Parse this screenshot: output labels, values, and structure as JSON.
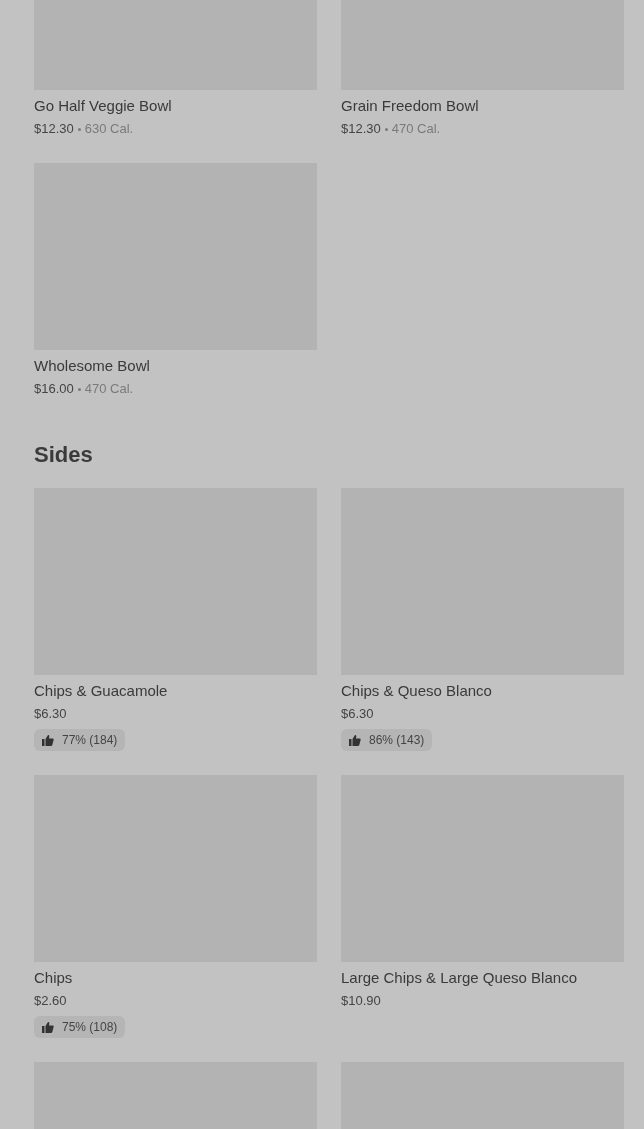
{
  "sections": [
    {
      "items": [
        {
          "kind": "item",
          "name": "Go Half Veggie Bowl",
          "price": "$12.30",
          "calories": "630 Cal."
        },
        {
          "kind": "item",
          "name": "Grain Freedom Bowl",
          "price": "$12.30",
          "calories": "470 Cal."
        },
        {
          "kind": "item",
          "name": "Wholesome Bowl",
          "price": "$16.00",
          "calories": "470 Cal."
        }
      ]
    },
    {
      "title": "Sides",
      "items": [
        {
          "kind": "item",
          "name": "Chips & Guacamole",
          "price": "$6.30",
          "rating": "77% (184)"
        },
        {
          "kind": "item",
          "name": "Chips & Queso Blanco",
          "price": "$6.30",
          "rating": "86% (143)"
        },
        {
          "kind": "item",
          "name": "Chips",
          "price": "$2.60",
          "rating": "75% (108)"
        },
        {
          "kind": "item",
          "name": "Large Chips & Large Queso Blanco",
          "price": "$10.90"
        },
        {
          "kind": "picture"
        },
        {
          "kind": "picture"
        }
      ]
    }
  ]
}
